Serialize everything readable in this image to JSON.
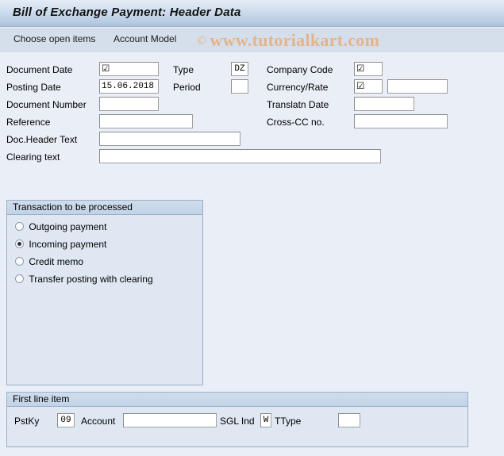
{
  "window": {
    "title": "Bill of Exchange Payment: Header Data"
  },
  "toolbar": {
    "choose_open_items_label": "Choose open items",
    "account_model_label": "Account Model"
  },
  "watermark": {
    "copyright_symbol": "©",
    "text": "www.tutorialkart.com",
    "color": "#e3b48c"
  },
  "header_form": {
    "left_column": [
      {
        "label": "Document Date",
        "value": "☑",
        "name": "document-date"
      },
      {
        "label": "Posting Date",
        "value": "15.06.2018",
        "name": "posting-date"
      },
      {
        "label": "Document Number",
        "value": "",
        "name": "document-number"
      },
      {
        "label": "Reference",
        "value": "",
        "name": "reference"
      },
      {
        "label": "Doc.Header Text",
        "value": "",
        "name": "doc-header-text"
      },
      {
        "label": "Clearing text",
        "value": "",
        "name": "clearing-text"
      }
    ],
    "middle_column": [
      {
        "label": "Type",
        "value": "DZ",
        "name": "document-type"
      },
      {
        "label": "Period",
        "value": "",
        "name": "period"
      }
    ],
    "right_column": [
      {
        "label": "Company Code",
        "value": "☑",
        "name": "company-code"
      },
      {
        "label": "Currency/Rate",
        "value": "☑",
        "name": "currency"
      },
      {
        "label": "Translatn Date",
        "value": "",
        "name": "translation-date"
      },
      {
        "label": "Cross-CC no.",
        "value": "",
        "name": "cross-cc-no"
      }
    ],
    "rate_value": ""
  },
  "transaction_group": {
    "title": "Transaction to be processed",
    "options": [
      {
        "label": "Outgoing payment",
        "selected": false
      },
      {
        "label": "Incoming payment",
        "selected": true
      },
      {
        "label": "Credit memo",
        "selected": false
      },
      {
        "label": "Transfer posting with clearing",
        "selected": false
      }
    ]
  },
  "first_line_item": {
    "title": "First line item",
    "pstky_label": "PstKy",
    "pstky_value": "09",
    "account_label": "Account",
    "account_value": "",
    "sgl_ind_label": "SGL Ind",
    "sgl_ind_value": "W",
    "ttype_label": "TType",
    "ttype_value": ""
  },
  "colors": {
    "page_background": "#e9eef7",
    "panel_background": "#dfe8f2",
    "panel_border": "#9ab0cb",
    "toolbar_background": "#d5dfeb",
    "title_accent": "#a8bed8"
  }
}
